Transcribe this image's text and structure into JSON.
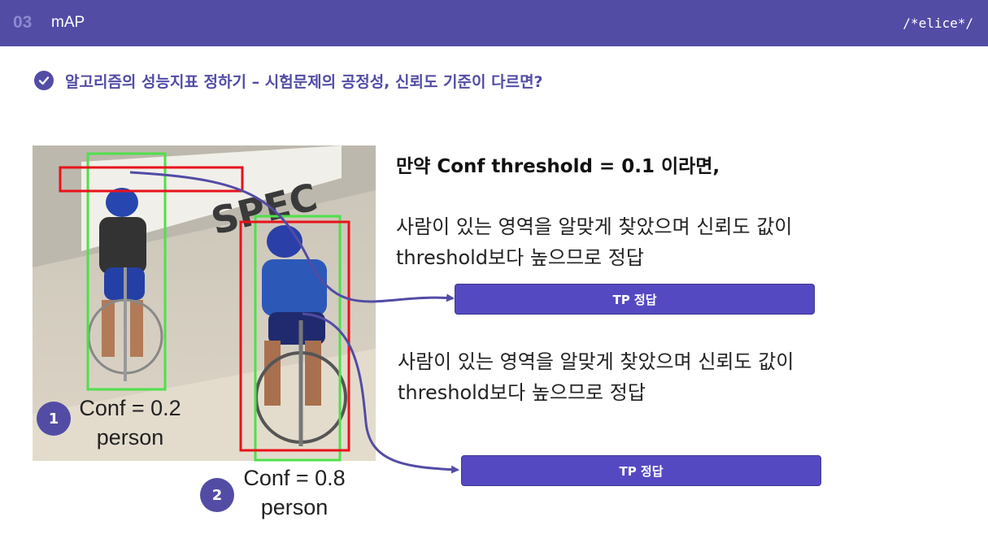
{
  "header": {
    "section_number": "03",
    "section_title": "mAP",
    "logo": "/*elice*/"
  },
  "headline": "알고리즘의 성능지표 정하기 – 시험문제의 공정성, 신뢰도 기준이 다르면?",
  "detections": [
    {
      "badge": "1",
      "conf": "Conf = 0.2",
      "class": "person"
    },
    {
      "badge": "2",
      "conf": "Conf = 0.8",
      "class": "person"
    }
  ],
  "explanation": {
    "title": "만약 Conf threshold = 0.1 이라면,",
    "items": [
      {
        "line1": "사람이 있는 영역을 알맞게 찾았으며 신뢰도 값이",
        "line2": "threshold보다 높으므로 정답",
        "result": "TP 정답"
      },
      {
        "line1": "사람이 있는 영역을 알맞게 찾았으며 신뢰도 값이",
        "line2": "threshold보다 높으므로 정답",
        "result": "TP 정답"
      }
    ]
  },
  "colors": {
    "accent": "#524ca5",
    "prediction_box": "#e8121b",
    "ground_truth_box": "#4fe04a"
  }
}
